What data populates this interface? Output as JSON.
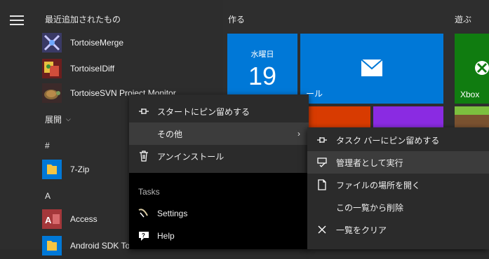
{
  "recent_header": "最近追加されたもの",
  "recent_apps": [
    {
      "label": "TortoiseMerge",
      "icon": "tortoisemerge-icon"
    },
    {
      "label": "TortoiseIDiff",
      "icon": "tortoiseidiff-icon"
    },
    {
      "label": "TortoiseSVN Project Monitor",
      "icon": "tortoisesvn-icon"
    }
  ],
  "expand_label": "展開",
  "sections": {
    "hash": "#",
    "a": "A"
  },
  "apps": [
    {
      "label": "7-Zip",
      "icon": "folder-icon"
    },
    {
      "label": "Access",
      "icon": "access-icon"
    },
    {
      "label": "Android SDK To",
      "icon": "folder-icon"
    }
  ],
  "groups": {
    "create": "作る",
    "play": "遊ぶ"
  },
  "tiles": {
    "calendar_day": "水曜日",
    "calendar_date": "19",
    "mail_label": "ール",
    "xbox_label": "Xbox"
  },
  "context_menu": {
    "items": [
      {
        "label": "スタートにピン留めする",
        "icon": "pin-icon"
      },
      {
        "label": "その他",
        "icon": "",
        "submenu_arrow": "›"
      },
      {
        "label": "アンインストール",
        "icon": "trash-icon"
      }
    ],
    "tasks_header": "Tasks",
    "tasks": [
      {
        "label": "Settings",
        "icon": "settings-icon"
      },
      {
        "label": "Help",
        "icon": "help-icon"
      }
    ]
  },
  "submenu": {
    "items": [
      {
        "label": "タスク バーにピン留めする",
        "icon": "pin-icon"
      },
      {
        "label": "管理者として実行",
        "icon": "shield-icon"
      },
      {
        "label": "ファイルの場所を開く",
        "icon": "file-icon"
      },
      {
        "label": "この一覧から削除",
        "icon": ""
      },
      {
        "label": "一覧をクリア",
        "icon": "close-icon"
      }
    ]
  },
  "colors": {
    "tile_blue": "#0078d7",
    "tile_green": "#107c10",
    "tile_orange": "#d83b01",
    "tile_purple": "#8a2be2",
    "access_red": "#a4373a"
  }
}
